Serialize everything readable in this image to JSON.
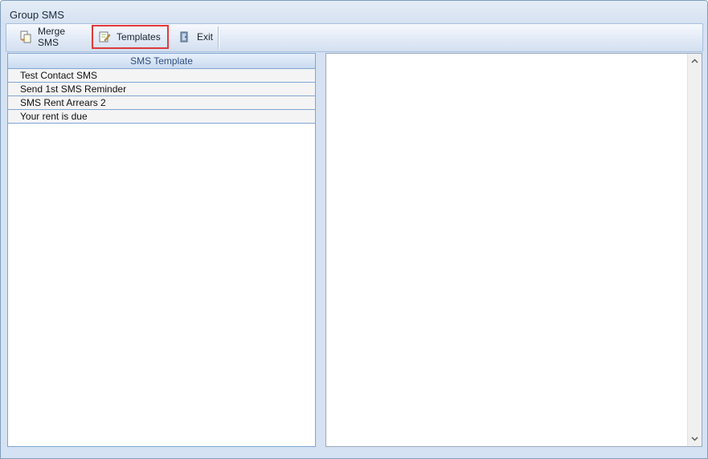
{
  "window": {
    "title": "Group SMS"
  },
  "toolbar": {
    "merge_label": "Merge SMS",
    "templates_label": "Templates",
    "exit_label": "Exit"
  },
  "template_list": {
    "header": "SMS Template",
    "items": [
      {
        "label": "Test Contact SMS"
      },
      {
        "label": "Send 1st SMS Reminder"
      },
      {
        "label": "SMS Rent Arrears 2"
      },
      {
        "label": "Your rent is due"
      }
    ]
  },
  "editor": {
    "content": ""
  },
  "colors": {
    "highlight_border": "#e03a3a",
    "header_text": "#2d4f86",
    "window_bg": "#d5e2f3"
  },
  "icons": {
    "merge": "merge-documents-icon",
    "templates": "edit-document-icon",
    "exit": "exit-door-icon",
    "scroll_up": "chevron-up-icon",
    "scroll_down": "chevron-down-icon"
  }
}
